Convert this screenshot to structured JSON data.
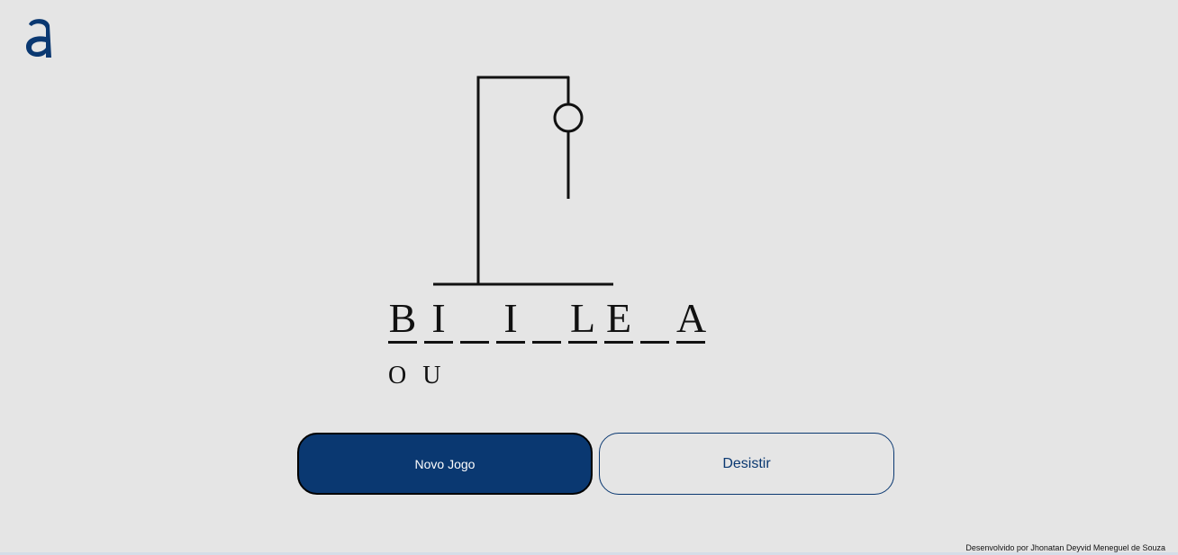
{
  "logo": {
    "icon": "alura-a-logo",
    "color": "#0a3871"
  },
  "hangman": {
    "stage_parts_visible": [
      "base",
      "pole",
      "beam",
      "rope",
      "head",
      "body"
    ],
    "icon": "gallows-icon"
  },
  "word": {
    "slots": [
      "B",
      "I",
      "",
      "I",
      "",
      "L",
      "E",
      "",
      "A"
    ]
  },
  "wrong_letters": [
    "O",
    "U"
  ],
  "buttons": {
    "new_game_label": "Novo Jogo",
    "give_up_label": "Desistir"
  },
  "footer": {
    "credit": "Desenvolvido por Jhonatan Deyvid Meneguel de Souza"
  },
  "colors": {
    "background": "#e5e5e5",
    "accent": "#0a3871",
    "ink": "#111111"
  }
}
